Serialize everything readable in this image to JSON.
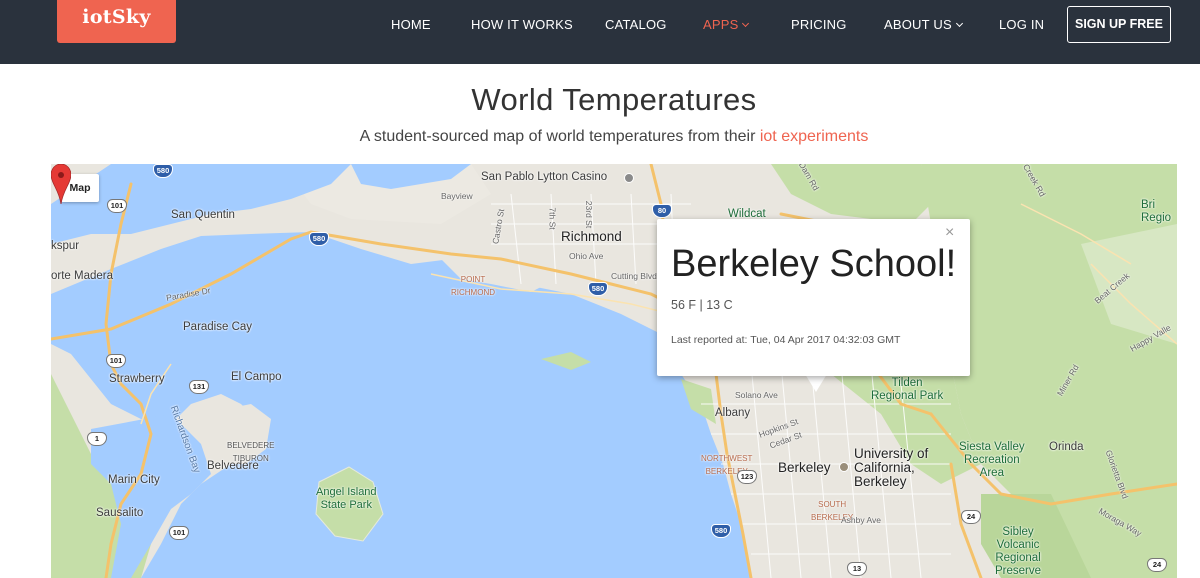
{
  "nav": {
    "logo": "iotSky",
    "items": [
      {
        "label": "HOME",
        "dropdown": false,
        "active": false
      },
      {
        "label": "HOW IT WORKS",
        "dropdown": false,
        "active": false
      },
      {
        "label": "CATALOG",
        "dropdown": false,
        "active": false
      },
      {
        "label": "APPS",
        "dropdown": true,
        "active": true
      },
      {
        "label": "PRICING",
        "dropdown": false,
        "active": false
      },
      {
        "label": "ABOUT US",
        "dropdown": true,
        "active": false
      },
      {
        "label": "LOG IN",
        "dropdown": false,
        "active": false
      }
    ],
    "signup": "SIGN UP FREE"
  },
  "header": {
    "title": "World Temperatures",
    "subtitle": "A student-sourced map of world temperatures from their",
    "subtitle_link": "iot experiments"
  },
  "map": {
    "type_button": "Map",
    "labels": {
      "richmond": "Richmond",
      "san_quentin": "San Quentin",
      "kspur": "kspur",
      "orte_madera": "orte Madera",
      "paradise_cay": "Paradise Cay",
      "strawberry": "Strawberry",
      "el_campo": "El Campo",
      "belvedere": "Belvedere",
      "belvedere_tiburon": "BELVEDERE\nTIBURON",
      "marin_city": "Marin City",
      "sausalito": "Sausalito",
      "angel_island": "Angel Island\nState Park",
      "richardson_bay": "Richardson Bay",
      "albany": "Albany",
      "berkeley": "Berkeley",
      "uc_berkeley": "University of\nCalifornia,\nBerkeley",
      "tilden": "Tilden\nRegional Park",
      "siesta_valley": "Siesta Valley\nRecreation\nArea",
      "orinda": "Orinda",
      "sibley": "Sibley\nVolcanic\nRegional\nPreserve",
      "wildcat": "Wildcat",
      "san_pablo_casino": "San Pablo Lytton Casino",
      "point_richmond": "POINT\nRICHMOND",
      "northwest_berkeley": "NORTHWEST\nBERKELEY",
      "south_berkeley": "SOUTH\nBERKELEY",
      "bri_region": "Bri\nRegio",
      "ohio_ave": "Ohio Ave",
      "cutting_blvd": "Cutting Blvd",
      "solano_ave": "Solano Ave",
      "cedar_st": "Cedar St",
      "hopkins_st": "Hopkins St",
      "ashby_ave": "Ashby Ave",
      "dam_rd": "Dam Rd",
      "castro_st": "Castro St",
      "seventh_st": "7th St",
      "twentythird_st": "23rd St",
      "creek_rd": "Creek Rd",
      "beat_creek": "Beat Creek",
      "happy_valley": "Happy Valle",
      "miner_rd": "Miner Rd",
      "moraga_way": "Moraga Way",
      "glorietta": "Glorietta Blvd",
      "bayview": "Bayview",
      "paradise_dr": "Paradise Dr",
      "corte": "Corte Madera"
    },
    "shields": {
      "h580a": "580",
      "h580b": "580",
      "h580c": "580",
      "h580d": "580",
      "h80": "80",
      "h101a": "101",
      "h101b": "101",
      "h101c": "101",
      "h131": "131",
      "h1": "1",
      "h123": "123",
      "h13": "13",
      "h24a": "24",
      "h24b": "24"
    }
  },
  "info_window": {
    "title": "Berkeley School!",
    "temperature": "56 F | 13 C",
    "reported": "Last reported at: Tue, 04 Apr 2017 04:32:03 GMT",
    "close": "×"
  },
  "colors": {
    "nav_bg": "#2a323d",
    "accent": "#ef6450",
    "water": "#a3ccff",
    "land": "#e9e6df",
    "park": "#c5dea8",
    "highway": "#f4c26b"
  }
}
